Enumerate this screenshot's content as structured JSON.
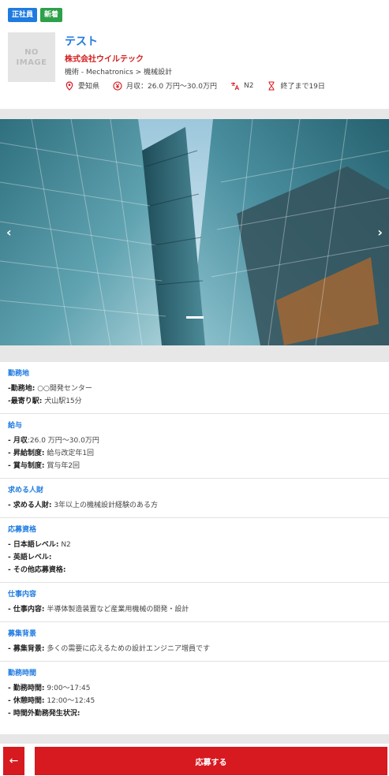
{
  "badges": {
    "type": "正社員",
    "new": "新着"
  },
  "logo": {
    "line1": "NO",
    "line2": "IMAGE"
  },
  "job": {
    "title": "テスト",
    "company": "株式会社ウイルテック",
    "category": "機術 - Mechatronics > 機械設計",
    "location": "愛知県",
    "salary": "月収：26.0 万円〜30.0万円",
    "language": "N2",
    "deadline": "終了まで19日"
  },
  "carousel": {
    "prev": "‹",
    "next": "›"
  },
  "sections": {
    "location": {
      "title": "勤務地",
      "rows": [
        {
          "k": "-勤務地:",
          "v": " ○○開発センター"
        },
        {
          "k": "-最寄り駅:",
          "v": " 犬山駅15分"
        }
      ]
    },
    "salary": {
      "title": "給与",
      "rows": [
        {
          "k": "- 月収",
          "v": ":26.0 万円〜30.0万円"
        },
        {
          "k": "- 昇給制度:",
          "v": " 給与改定年1回"
        },
        {
          "k": "- 賞与制度:",
          "v": " 賞与年2回"
        }
      ]
    },
    "talent": {
      "title": "求める人財",
      "rows": [
        {
          "k": "- 求める人財:",
          "v": " 3年以上の機械設計経験のある方"
        }
      ]
    },
    "qualification": {
      "title": "応募資格",
      "rows": [
        {
          "k": "- 日本語レベル:",
          "v": " N2"
        },
        {
          "k": "- 英語レベル:",
          "v": ""
        },
        {
          "k": "- その他応募資格:",
          "v": ""
        }
      ]
    },
    "work": {
      "title": "仕事内容",
      "rows": [
        {
          "k": "- 仕事内容:",
          "v": " 半導体製造装置など産業用機械の開発・設計"
        }
      ]
    },
    "background": {
      "title": "募集背景",
      "rows": [
        {
          "k": "- 募集背景:",
          "v": " 多くの需要に応えるための設計エンジニア増員です"
        }
      ]
    },
    "hours": {
      "title": "勤務時間",
      "rows": [
        {
          "k": "- 勤務時間:",
          "v": " 9:00〜17:45"
        },
        {
          "k": "- 休憩時間:",
          "v": " 12:00〜12:45"
        },
        {
          "k": "- 時間外勤務発生状況:",
          "v": ""
        }
      ]
    }
  },
  "footer": {
    "back_icon": "←",
    "apply_label": "応募する"
  }
}
